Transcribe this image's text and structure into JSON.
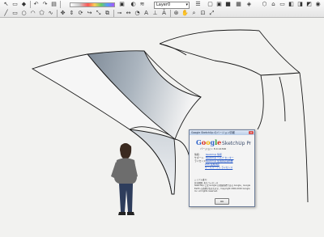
{
  "toolbar": {
    "layer_value": "Layer0"
  },
  "about_dialog": {
    "title": "Google SketchUp のバージョン情報",
    "logo_google": "Google",
    "logo_product": "SketchUp Pro",
    "version": "バージョン: 8.0.14346",
    "rows": [
      {
        "label": "情報:",
        "link": "SketchUp 情報"
      },
      {
        "label": "サポート:",
        "link": "SketchUp ヘルプ センター"
      },
      {
        "label": "ライセンス:",
        "link": "SketchUp 使用許諾契約書"
      },
      {
        "label": "",
        "link": "OSS 使用許諾"
      },
      {
        "label": "",
        "link": "サードパーティ ライセンス"
      }
    ],
    "license_line1": "シリアル番号:",
    "license_line2": "有効期限: 永久ライセンス",
    "copyright": "SketchUp には Google の登録商標である Google、Google Earth の商標が含まれます。Copyright 2000-2010 Google Inc. All rights reserved.",
    "ok_label": "OK"
  },
  "colors": {
    "viewport_bg": "#f2f2f0",
    "toolbar_bg": "#e8e8e8",
    "surface_gray": "#8f9aa5",
    "surface_light": "#f2f2f2",
    "edge": "#1a1a1a",
    "link": "#1a4fc4",
    "google_blue": "#3366cc",
    "google_red": "#d52a1e",
    "google_yellow": "#f0b000",
    "google_green": "#2e9a3a"
  }
}
